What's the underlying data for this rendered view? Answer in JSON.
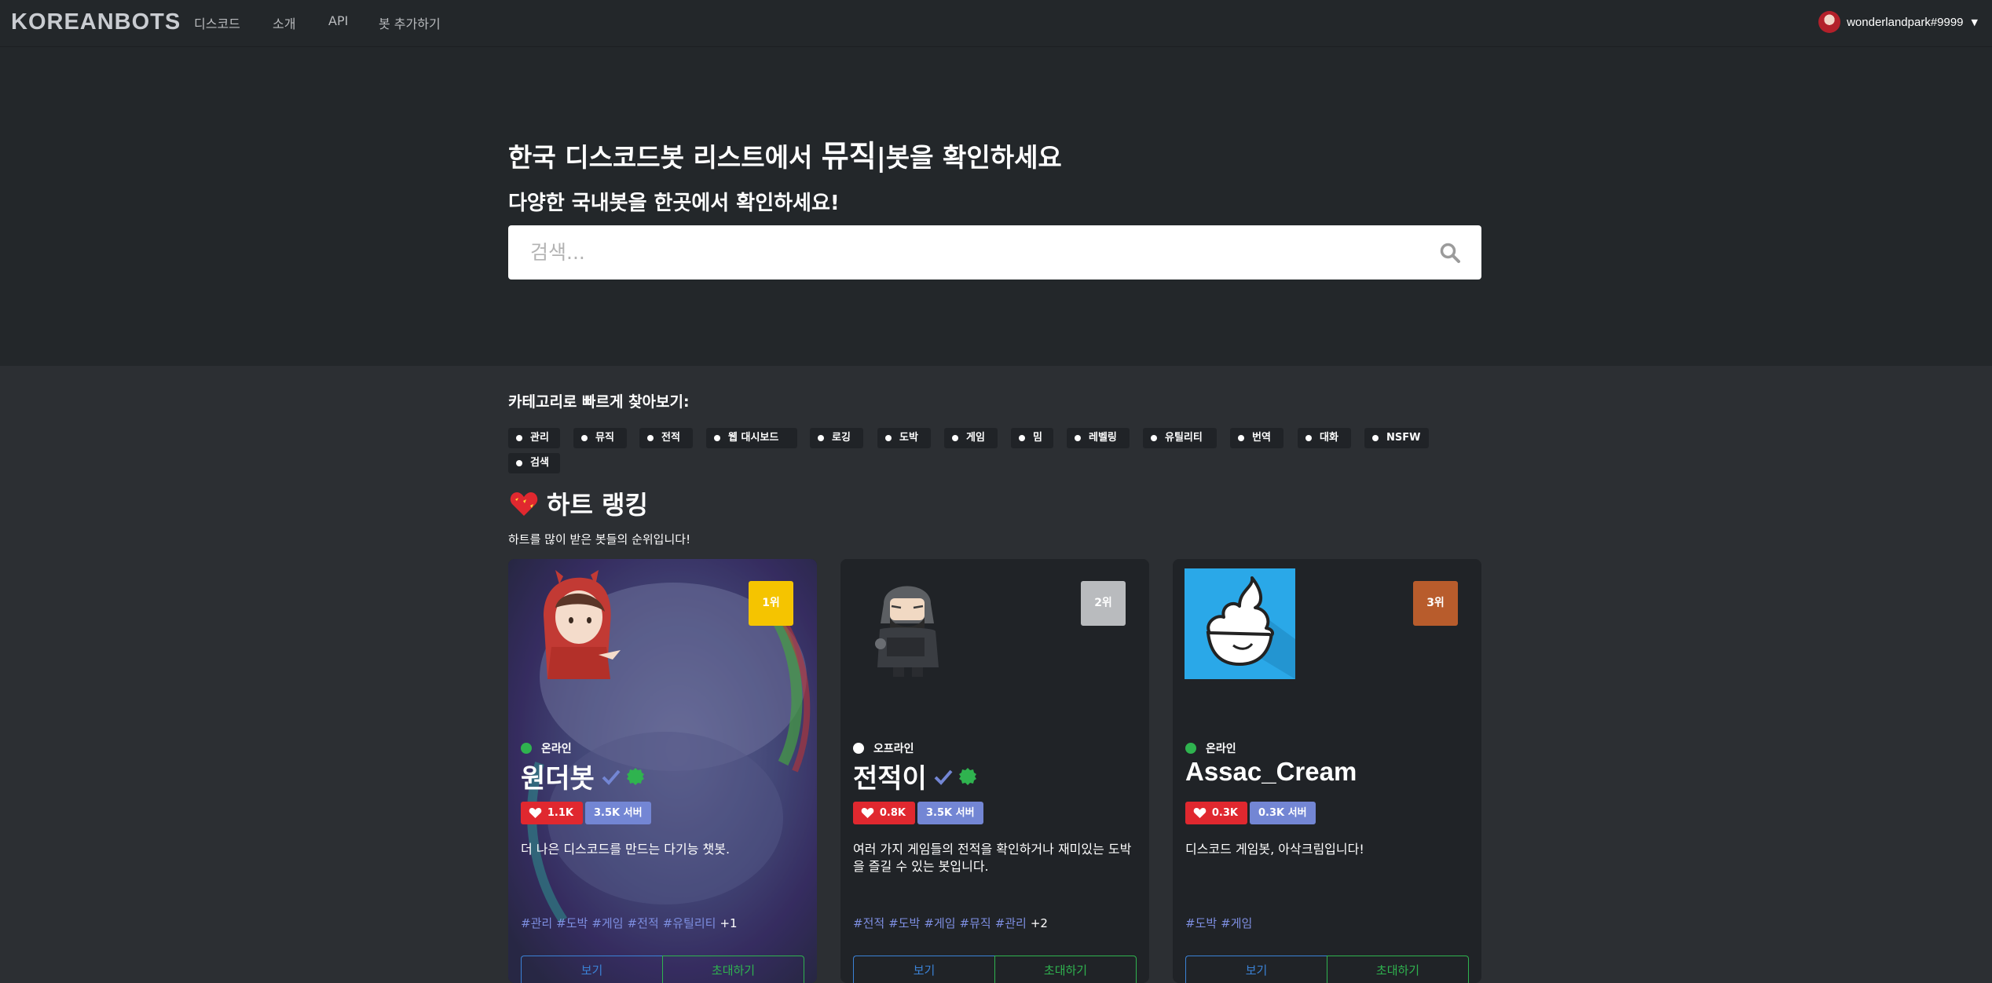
{
  "nav": {
    "brand": "KOREANBOTS",
    "links": [
      "디스코드",
      "소개",
      "API",
      "봇 추가하기"
    ],
    "user": {
      "name": "wonderlandpark#9999"
    }
  },
  "hero": {
    "title_before": "한국 디스코드봇 리스트에서 ",
    "title_rotating": "뮤직",
    "title_cursor": "|",
    "title_after": "봇을 확인하세요",
    "subtitle": "다양한 국내봇을 한곳에서 확인하세요!",
    "search_placeholder": "검색..."
  },
  "categories": {
    "title": "카테고리로 빠르게 찾아보기:",
    "items": [
      "관리",
      "뮤직",
      "전적",
      "웹 대시보드",
      "로깅",
      "도박",
      "게임",
      "밈",
      "레벨링",
      "유틸리티",
      "번역",
      "대화",
      "NSFW",
      "검색"
    ]
  },
  "ranking": {
    "title": "하트 랭킹",
    "subtitle": "하트를 많이 받은 봇들의 순위입니다!",
    "cards": [
      {
        "rank": "1위",
        "rank_color": "#f5c400",
        "status": "온라인",
        "status_color": "#2fb34f",
        "name": "원더봇",
        "verified": true,
        "partner": true,
        "hearts": "1.1K",
        "servers": "3.5K 서버",
        "description": "더 나은 디스코드를 만드는 다기능 챗봇.",
        "tags": [
          "#관리",
          "#도박",
          "#게임",
          "#전적",
          "#유틸리티"
        ],
        "more": "+1",
        "view": "보기",
        "invite": "초대하기"
      },
      {
        "rank": "2위",
        "rank_color": "#b9bbbe",
        "status": "오프라인",
        "status_color": "#ffffff",
        "name": "전적이",
        "verified": true,
        "partner": true,
        "hearts": "0.8K",
        "servers": "3.5K 서버",
        "description": "여러 가지 게임들의 전적을 확인하거나 재미있는 도박을 즐길 수 있는 봇입니다.",
        "tags": [
          "#전적",
          "#도박",
          "#게임",
          "#뮤직",
          "#관리"
        ],
        "more": "+2",
        "view": "보기",
        "invite": "초대하기"
      },
      {
        "rank": "3위",
        "rank_color": "#b85c2c",
        "status": "온라인",
        "status_color": "#2fb34f",
        "name": "Assac_Cream",
        "verified": false,
        "partner": false,
        "hearts": "0.3K",
        "servers": "0.3K 서버",
        "description": "디스코드 게임봇, 아삭크림입니다!",
        "tags": [
          "#도박",
          "#게임"
        ],
        "more": "",
        "view": "보기",
        "invite": "초대하기"
      }
    ]
  }
}
